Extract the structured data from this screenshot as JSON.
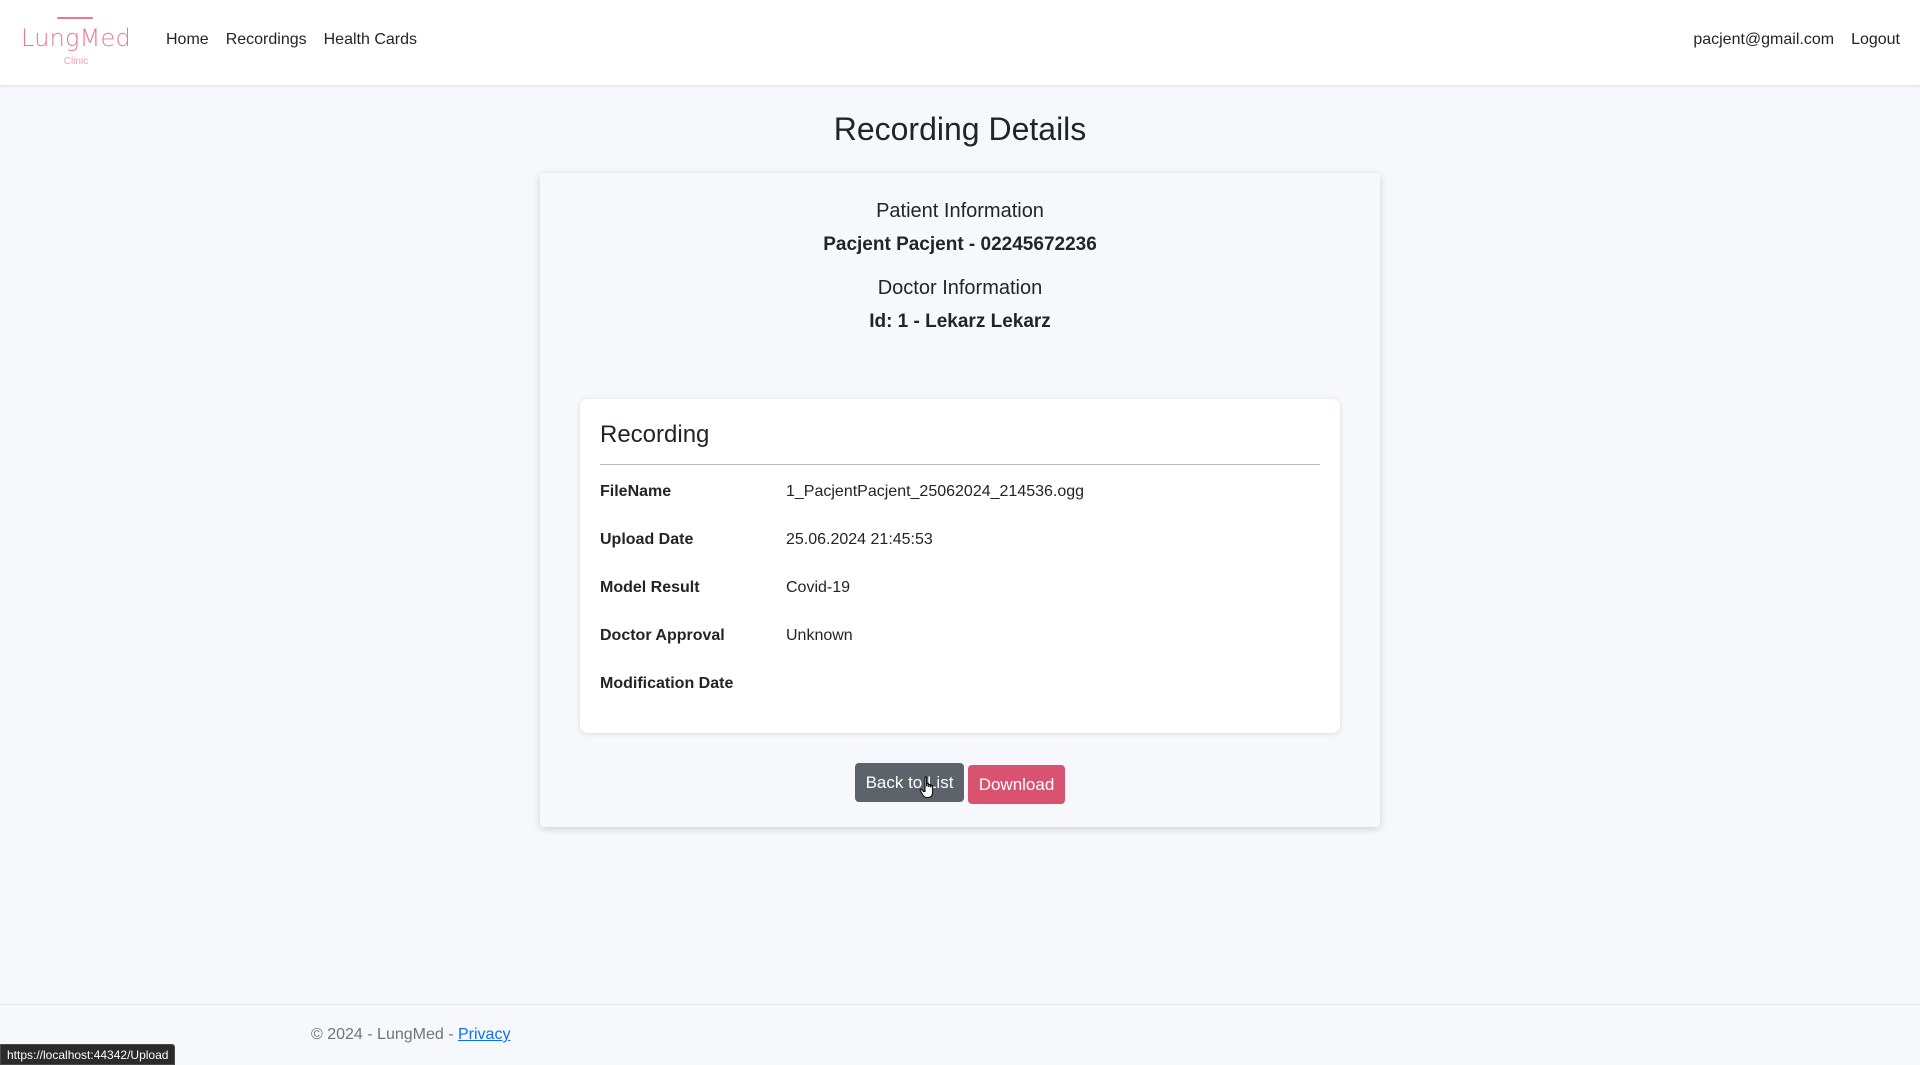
{
  "brand": {
    "name": "LungMed",
    "subtitle": "Clinic",
    "color": "#e8788f"
  },
  "nav": {
    "links": [
      "Home",
      "Recordings",
      "Health Cards"
    ],
    "user_email": "pacjent@gmail.com",
    "logout_label": "Logout"
  },
  "page": {
    "title": "Recording Details"
  },
  "patient": {
    "label": "Patient Information",
    "value": "Pacjent Pacjent - 02245672236"
  },
  "doctor": {
    "label": "Doctor Information",
    "value": "Id: 1 - Lekarz Lekarz"
  },
  "recording": {
    "title": "Recording",
    "fields": [
      {
        "key": "FileName",
        "value": "1_PacjentPacjent_25062024_214536.ogg"
      },
      {
        "key": "Upload Date",
        "value": "25.06.2024 21:45:53"
      },
      {
        "key": "Model Result",
        "value": "Covid-19"
      },
      {
        "key": "Doctor Approval",
        "value": "Unknown"
      },
      {
        "key": "Modification Date",
        "value": ""
      }
    ]
  },
  "actions": {
    "back_label": "Back to List",
    "download_label": "Download",
    "back_color": "#5c636a",
    "download_color": "#d9526f"
  },
  "footer": {
    "text": "© 2024 - LungMed - ",
    "privacy_label": "Privacy"
  },
  "status_bar": {
    "url": "https://localhost:44342/Upload"
  }
}
